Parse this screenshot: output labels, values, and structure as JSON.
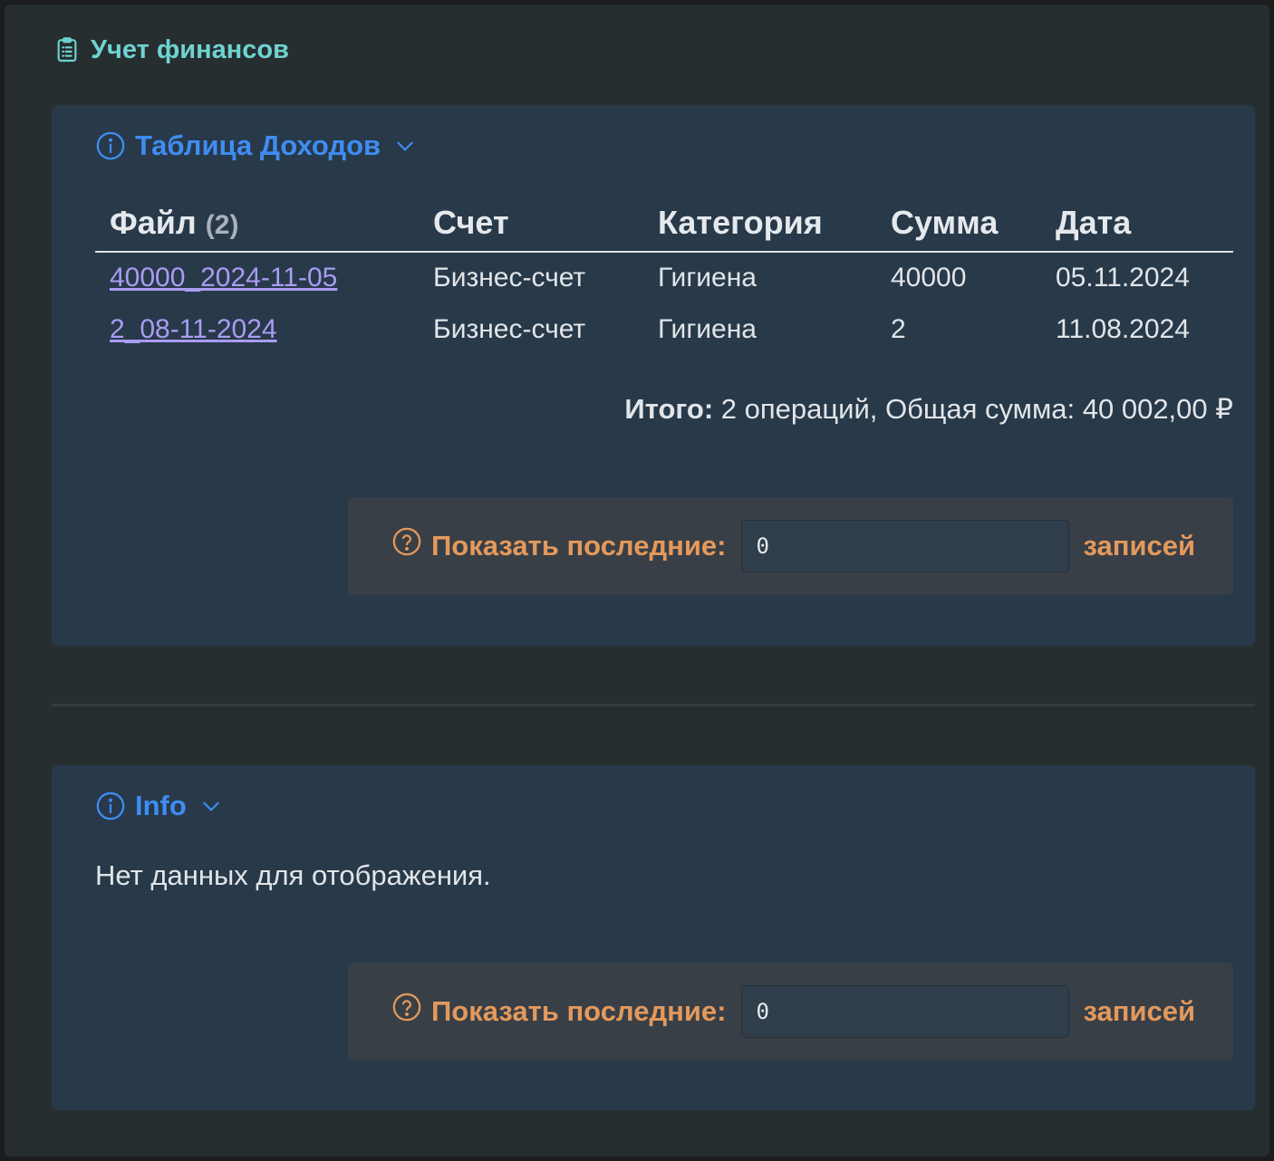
{
  "app": {
    "title": "Учет финансов",
    "icon": "clipboard-icon",
    "accent": "#6fd3d1"
  },
  "income_panel": {
    "title": "Таблица Доходов",
    "icon": "info-circle-icon",
    "toggle_icon": "chevron-down-icon",
    "columns": {
      "file": "Файл",
      "file_count": "(2)",
      "account": "Счет",
      "category": "Категория",
      "amount": "Сумма",
      "date": "Дата"
    },
    "rows": [
      {
        "file": "40000_2024-11-05",
        "account": "Бизнес-счет",
        "category": "Гигиена",
        "amount": "40000",
        "date": "05.11.2024"
      },
      {
        "file": "2_08-11-2024",
        "account": "Бизнес-счет",
        "category": "Гигиена",
        "amount": "2",
        "date": "11.08.2024"
      }
    ],
    "summary_label": "Итого:",
    "summary_text": " 2 операций, Общая сумма: 40 002,00 ₽",
    "filter": {
      "label": "Показать последние:",
      "value": "0",
      "suffix": "записей",
      "icon": "question-circle-icon"
    }
  },
  "info_panel": {
    "title": "Info",
    "icon": "info-circle-icon",
    "toggle_icon": "chevron-down-icon",
    "empty_message": "Нет данных для отображения.",
    "filter": {
      "label": "Показать последние:",
      "value": "0",
      "suffix": "записей",
      "icon": "question-circle-icon"
    }
  },
  "colors": {
    "background": "#262e30",
    "panel": "#28394a",
    "title_blue": "#3f8df2",
    "filter_orange": "#e3995c",
    "link": "#a99cf2"
  }
}
